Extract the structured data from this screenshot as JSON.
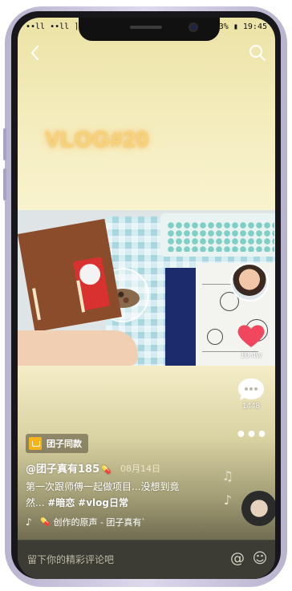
{
  "status_bar": {
    "left": "∙∙ll ∙∙ll ⌉ K",
    "right": "3% ▮ 19:45"
  },
  "nav": {
    "back_icon": "back-chevron-icon",
    "search_icon": "search-icon"
  },
  "video": {
    "overlay_title": "VLOG#20"
  },
  "sidebar": {
    "like_count": "10.4w",
    "comment_count": "1448",
    "more_label": "•••"
  },
  "post": {
    "tag_label": "团子同款",
    "author": "@团子真有185",
    "author_emoji": "💊",
    "date": "08月14日",
    "desc_line1": "第一次跟师傅一起做项目...没想到竟",
    "desc_line2_prefix": "然...",
    "hashtag1": "#暗恋",
    "hashtag2": "#vlog日常",
    "sound_emoji": "💊",
    "sound_text": "创作的原声 - 团子真有`"
  },
  "comment_bar": {
    "placeholder": "留下你的精彩评论吧",
    "at_icon": "@",
    "emoji_icon": "☺"
  },
  "colors": {
    "like_red": "#f0475f",
    "title_glow": "#f6d27a"
  }
}
